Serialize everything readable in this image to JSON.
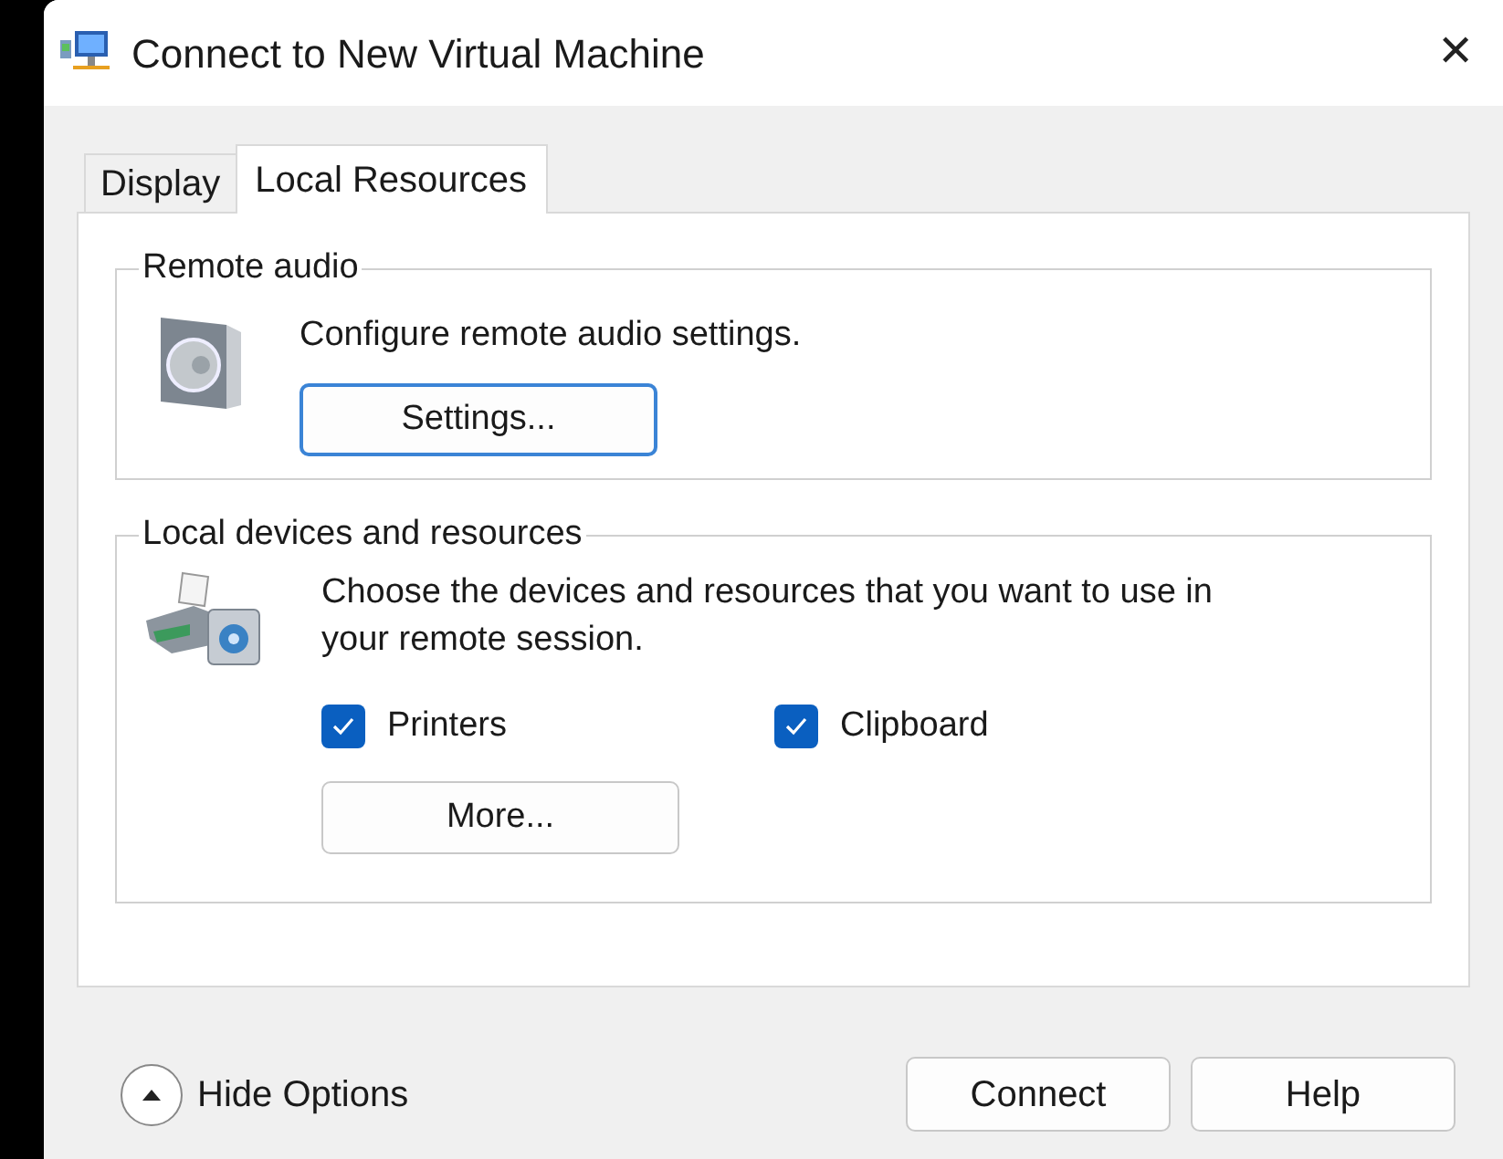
{
  "window": {
    "title": "Connect to New Virtual Machine",
    "close": "✕"
  },
  "tabs": [
    {
      "label": "Display",
      "selected": false
    },
    {
      "label": "Local Resources",
      "selected": true
    }
  ],
  "remote_audio": {
    "legend": "Remote audio",
    "description": "Configure remote audio settings.",
    "button": "Settings..."
  },
  "local_devices": {
    "legend": "Local devices and resources",
    "description": "Choose the devices and resources that you want to use in your remote session.",
    "checkboxes": [
      {
        "label": "Printers",
        "checked": true
      },
      {
        "label": "Clipboard",
        "checked": true
      }
    ],
    "button": "More..."
  },
  "options_toggle": {
    "label": "Hide Options",
    "expanded": true
  },
  "buttons": [
    "Connect",
    "Help"
  ]
}
